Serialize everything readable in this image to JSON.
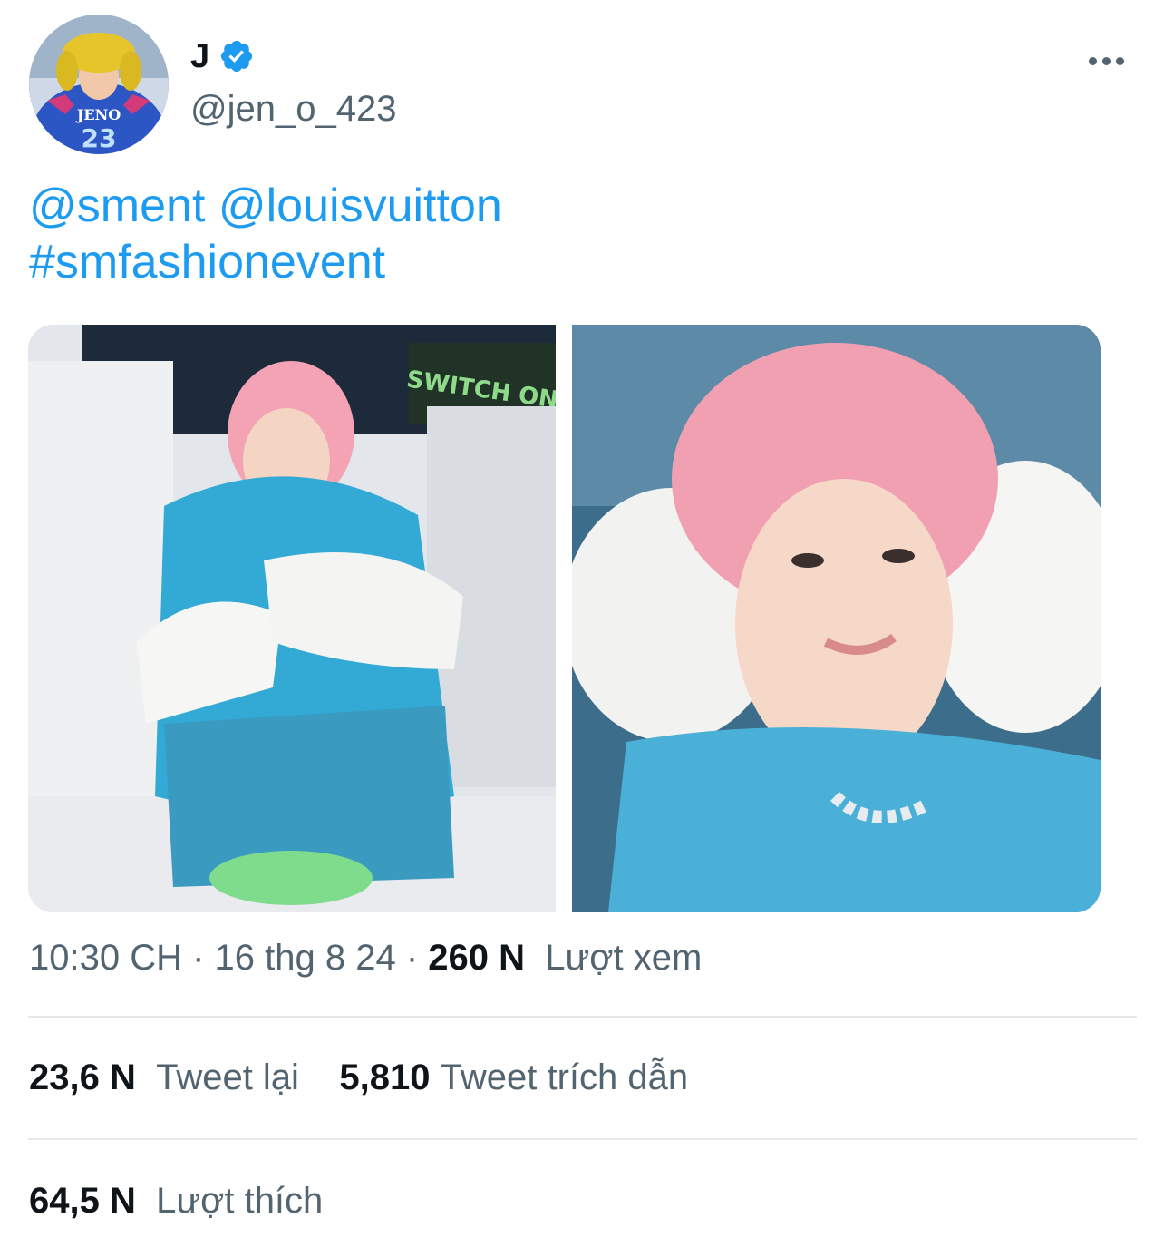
{
  "author": {
    "display_name": "J",
    "handle": "@jen_o_423",
    "verified": true,
    "avatar_jersey_text": "JENO",
    "avatar_jersey_number": "23"
  },
  "tweet": {
    "mentions": [
      "@sment",
      "@louisvuitton"
    ],
    "hashtag": "#smfashionevent",
    "photo_sign_text": "SWITCH ON"
  },
  "meta": {
    "time": "10:30 CH",
    "separator": " · ",
    "date": "16 thg 8 24",
    "views_count": "260 N",
    "views_label": "Lượt xem"
  },
  "stats": {
    "retweets_count": "23,6 N",
    "retweets_label": "Tweet lại",
    "quotes_count": "5,810",
    "quotes_label": "Tweet trích dẫn",
    "likes_count": "64,5 N",
    "likes_label": "Lượt thích"
  },
  "colors": {
    "link": "#1d9bf0",
    "text_primary": "#0f1419",
    "text_secondary": "#536471",
    "divider": "#e7e7e7"
  },
  "icons": [
    "verified-badge-icon",
    "more-options-icon"
  ]
}
